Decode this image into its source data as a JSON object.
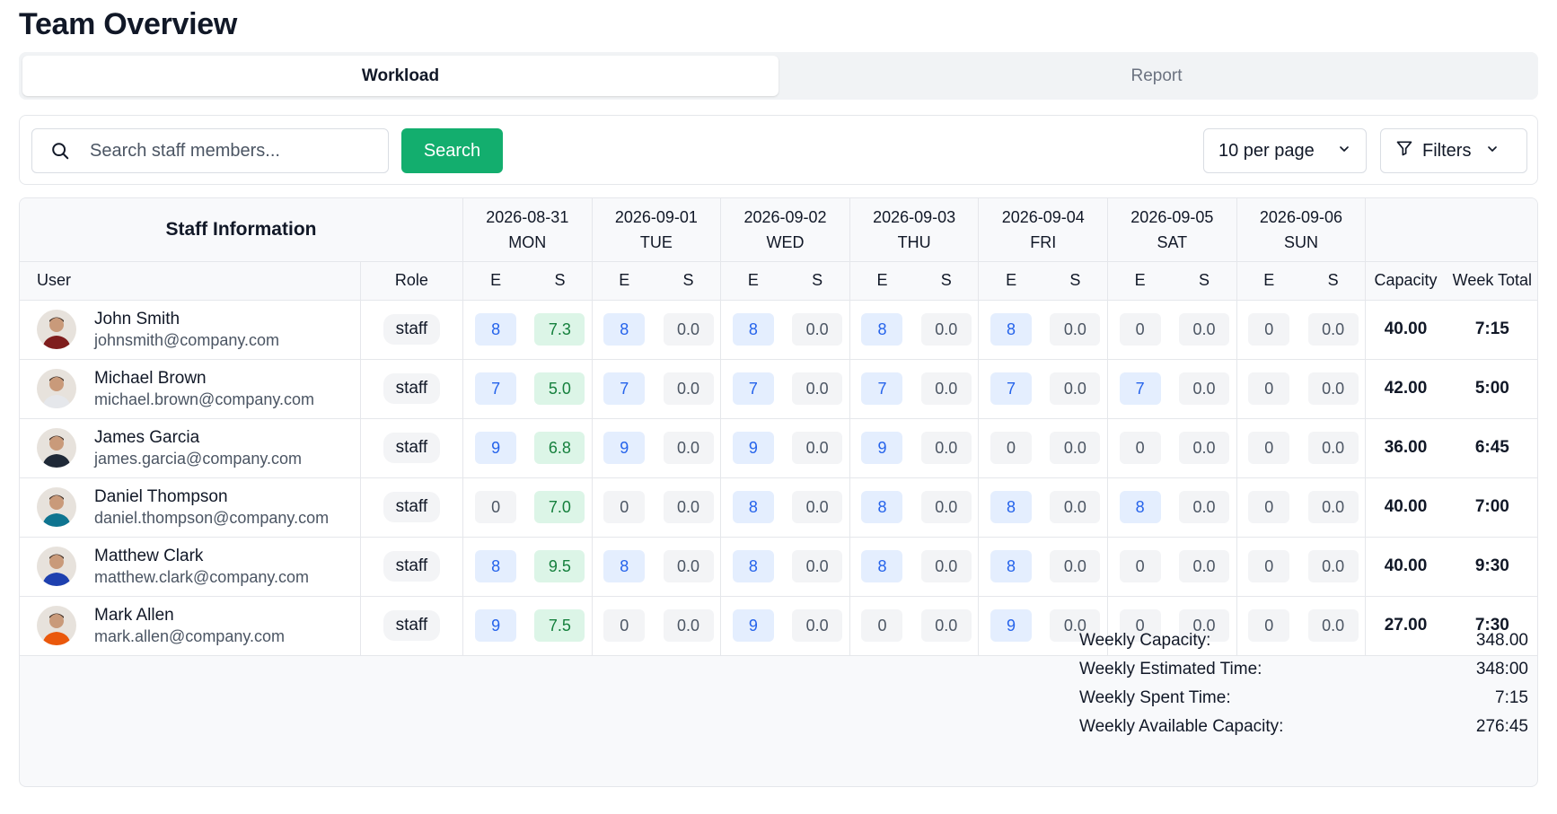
{
  "page": {
    "title": "Team Overview"
  },
  "tabs": [
    {
      "label": "Workload",
      "active": true
    },
    {
      "label": "Report",
      "active": false
    }
  ],
  "toolbar": {
    "search_placeholder": "Search staff members...",
    "search_button": "Search",
    "per_page": "10 per page",
    "filters": "Filters"
  },
  "table": {
    "staff_info_header": "Staff Information",
    "user_header": "User",
    "role_header": "Role",
    "capacity_header": "Capacity",
    "week_total_header": "Week Total",
    "estimated_short": "E",
    "spent_short": "S",
    "days": [
      {
        "date": "2026-08-31",
        "day": "MON"
      },
      {
        "date": "2026-09-01",
        "day": "TUE"
      },
      {
        "date": "2026-09-02",
        "day": "WED"
      },
      {
        "date": "2026-09-03",
        "day": "THU"
      },
      {
        "date": "2026-09-04",
        "day": "FRI"
      },
      {
        "date": "2026-09-05",
        "day": "SAT"
      },
      {
        "date": "2026-09-06",
        "day": "SUN"
      }
    ],
    "rows": [
      {
        "name": "John Smith",
        "email": "johnsmith@company.com",
        "role": "staff",
        "cells": [
          [
            "8",
            "7.3"
          ],
          [
            "8",
            "0.0"
          ],
          [
            "8",
            "0.0"
          ],
          [
            "8",
            "0.0"
          ],
          [
            "8",
            "0.0"
          ],
          [
            "0",
            "0.0"
          ],
          [
            "0",
            "0.0"
          ]
        ],
        "capacity": "40.00",
        "week_total": "7:15",
        "avatar_color": "#7f1d1d"
      },
      {
        "name": "Michael Brown",
        "email": "michael.brown@company.com",
        "role": "staff",
        "cells": [
          [
            "7",
            "5.0"
          ],
          [
            "7",
            "0.0"
          ],
          [
            "7",
            "0.0"
          ],
          [
            "7",
            "0.0"
          ],
          [
            "7",
            "0.0"
          ],
          [
            "7",
            "0.0"
          ],
          [
            "0",
            "0.0"
          ]
        ],
        "capacity": "42.00",
        "week_total": "5:00",
        "avatar_color": "#e5e7eb"
      },
      {
        "name": "James Garcia",
        "email": "james.garcia@company.com",
        "role": "staff",
        "cells": [
          [
            "9",
            "6.8"
          ],
          [
            "9",
            "0.0"
          ],
          [
            "9",
            "0.0"
          ],
          [
            "9",
            "0.0"
          ],
          [
            "0",
            "0.0"
          ],
          [
            "0",
            "0.0"
          ],
          [
            "0",
            "0.0"
          ]
        ],
        "capacity": "36.00",
        "week_total": "6:45",
        "avatar_color": "#1f2937"
      },
      {
        "name": "Daniel Thompson",
        "email": "daniel.thompson@company.com",
        "role": "staff",
        "cells": [
          [
            "0",
            "7.0"
          ],
          [
            "0",
            "0.0"
          ],
          [
            "8",
            "0.0"
          ],
          [
            "8",
            "0.0"
          ],
          [
            "8",
            "0.0"
          ],
          [
            "8",
            "0.0"
          ],
          [
            "0",
            "0.0"
          ]
        ],
        "capacity": "40.00",
        "week_total": "7:00",
        "avatar_color": "#0e7490"
      },
      {
        "name": "Matthew Clark",
        "email": "matthew.clark@company.com",
        "role": "staff",
        "cells": [
          [
            "8",
            "9.5"
          ],
          [
            "8",
            "0.0"
          ],
          [
            "8",
            "0.0"
          ],
          [
            "8",
            "0.0"
          ],
          [
            "8",
            "0.0"
          ],
          [
            "0",
            "0.0"
          ],
          [
            "0",
            "0.0"
          ]
        ],
        "capacity": "40.00",
        "week_total": "9:30",
        "avatar_color": "#1e40af"
      },
      {
        "name": "Mark Allen",
        "email": "mark.allen@company.com",
        "role": "staff",
        "cells": [
          [
            "9",
            "7.5"
          ],
          [
            "0",
            "0.0"
          ],
          [
            "9",
            "0.0"
          ],
          [
            "0",
            "0.0"
          ],
          [
            "9",
            "0.0"
          ],
          [
            "0",
            "0.0"
          ],
          [
            "0",
            "0.0"
          ]
        ],
        "capacity": "27.00",
        "week_total": "7:30",
        "avatar_color": "#ea580c"
      }
    ]
  },
  "summary": [
    {
      "label": "Weekly Capacity:",
      "value": "348.00"
    },
    {
      "label": "Weekly Estimated Time:",
      "value": "348:00"
    },
    {
      "label": "Weekly Spent Time:",
      "value": "7:15"
    },
    {
      "label": "Weekly Available Capacity:",
      "value": "276:45"
    }
  ],
  "colors": {
    "accent_green": "#13ae6e",
    "estimated_pill_bg": "#e4eefe",
    "estimated_pill_text": "#2563eb",
    "spent_pill_bg": "#dcf5e7",
    "spent_pill_text": "#15803d"
  },
  "icons": {
    "search": "search-icon",
    "chevron": "chevron-down-icon",
    "filter": "filter-icon"
  }
}
